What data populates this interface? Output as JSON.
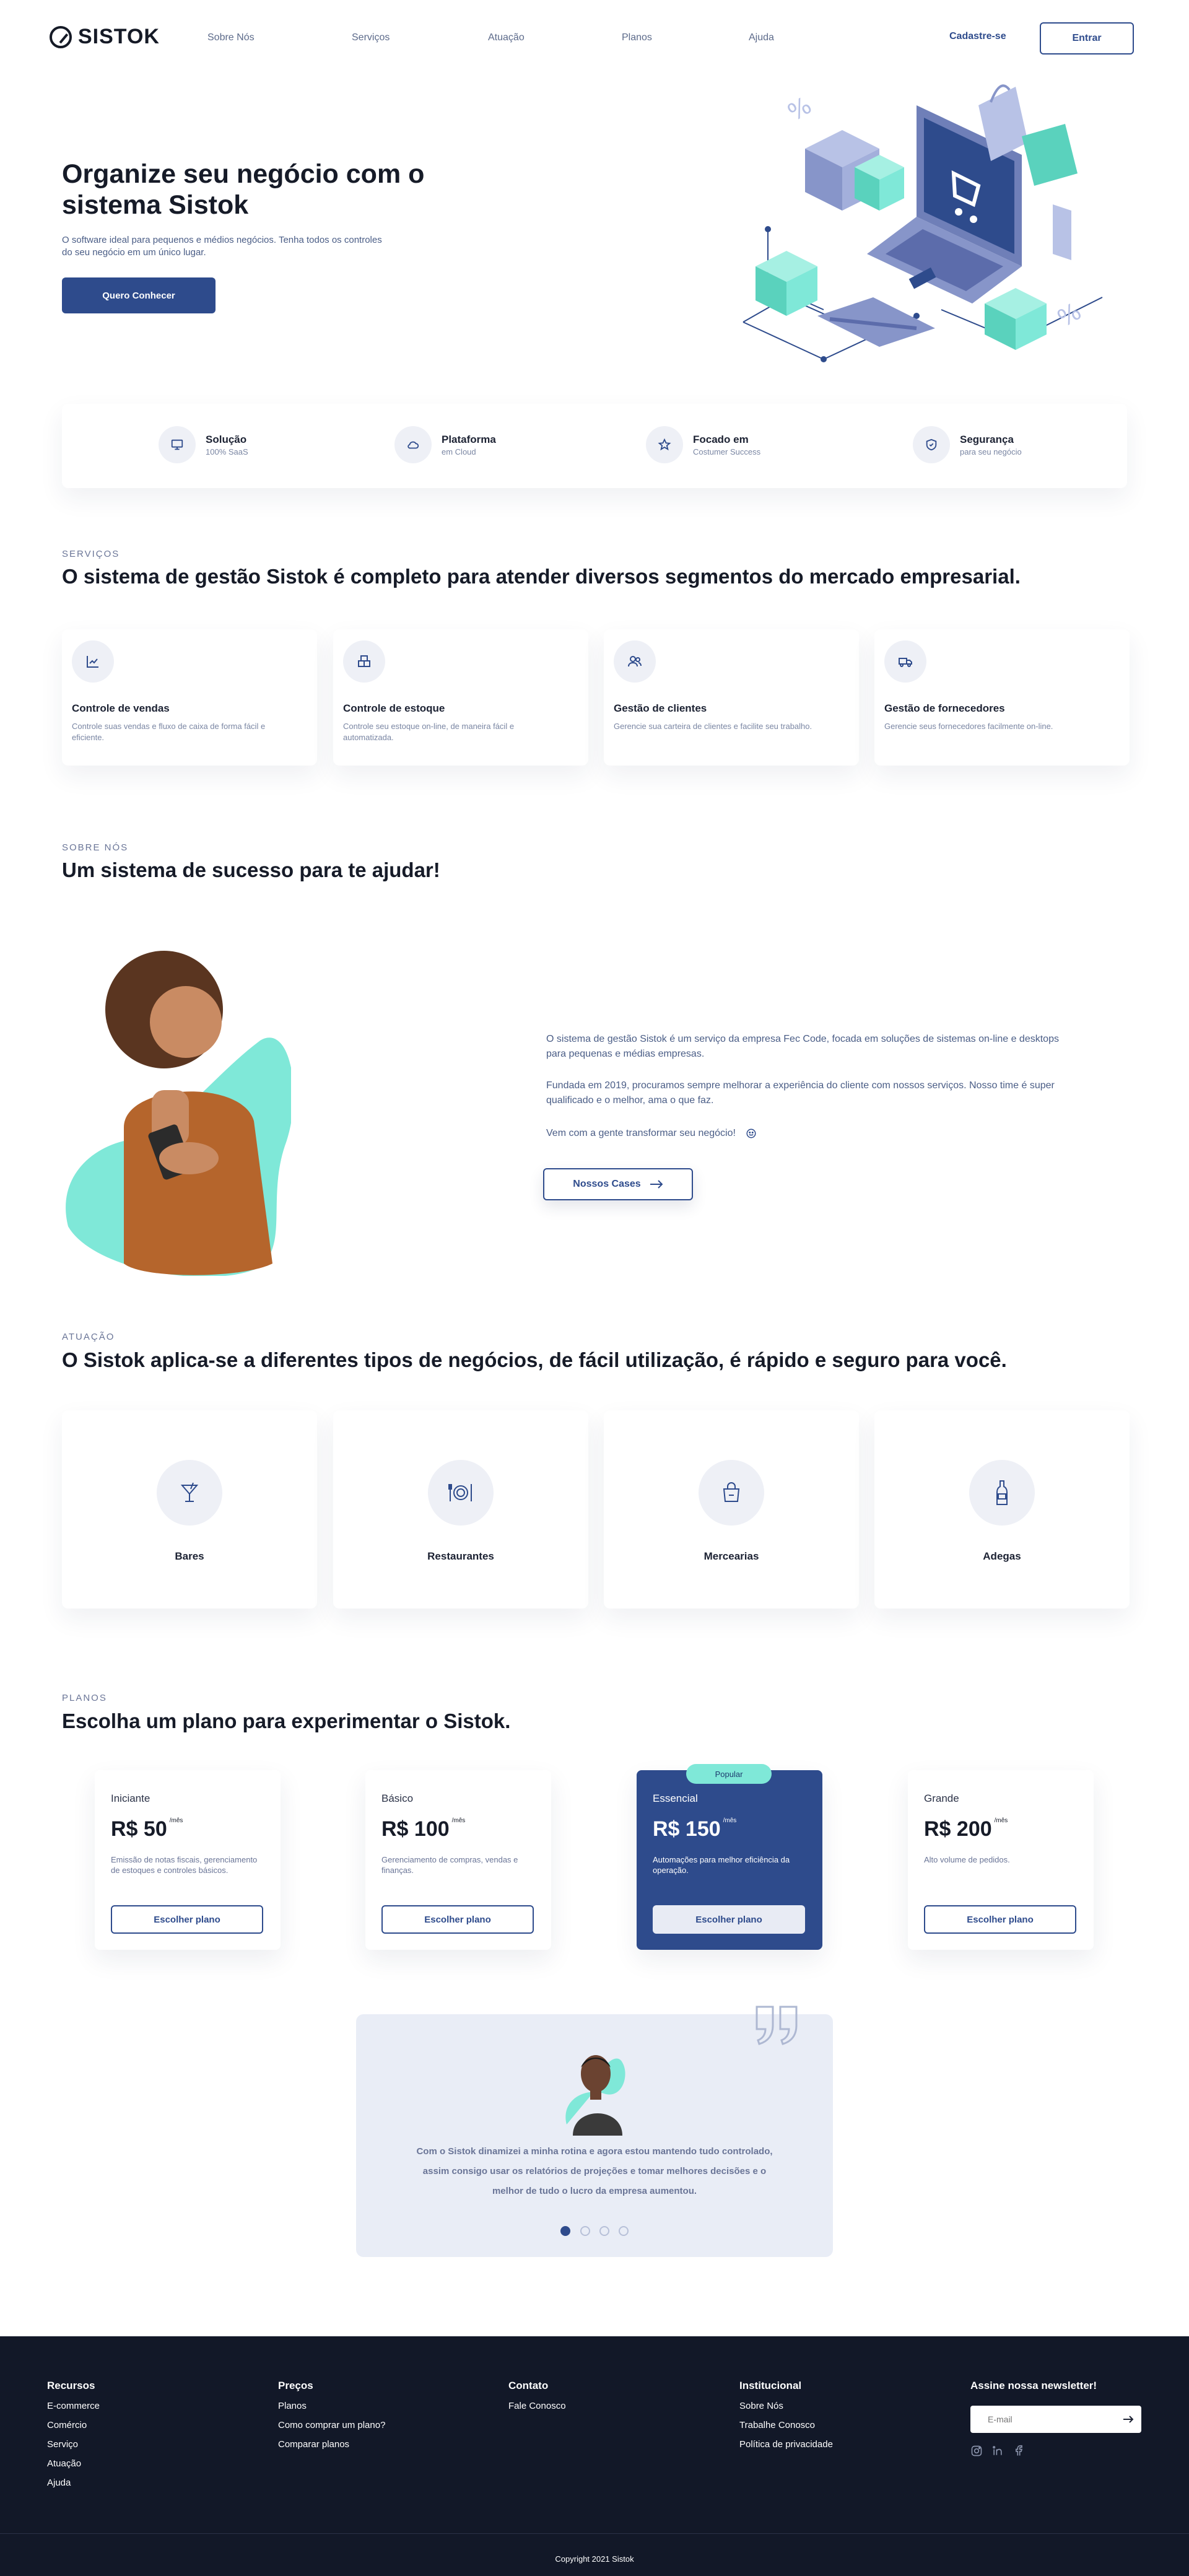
{
  "header": {
    "brand": "SISTOK",
    "nav": [
      "Sobre Nós",
      "Serviços",
      "Atuação",
      "Planos",
      "Ajuda"
    ],
    "signup": "Cadastre-se",
    "login": "Entrar"
  },
  "hero": {
    "title": "Organize seu negócio com o sistema Sistok",
    "subtitle": "O software ideal para pequenos e médios negócios. Tenha todos os controles do seu negócio em um único lugar.",
    "cta": "Quero Conhecer"
  },
  "features": [
    {
      "title": "Solução",
      "subtitle": "100% SaaS",
      "icon": "monitor-icon"
    },
    {
      "title": "Plataforma",
      "subtitle": "em Cloud",
      "icon": "cloud-icon"
    },
    {
      "title": "Focado em",
      "subtitle": "Costumer Success",
      "icon": "star-icon"
    },
    {
      "title": "Segurança",
      "subtitle": "para seu negócio",
      "icon": "shield-icon"
    }
  ],
  "services": {
    "eyebrow": "SERVIÇOS",
    "title": "O sistema de gestão Sistok é completo para atender diversos segmentos do mercado empresarial.",
    "items": [
      {
        "title": "Controle de vendas",
        "desc": "Controle suas vendas e fluxo de caixa de forma fácil e eficiente.",
        "icon": "chart-icon"
      },
      {
        "title": "Controle de estoque",
        "desc": "Controle seu estoque on-line, de maneira fácil e automatizada.",
        "icon": "boxes-icon"
      },
      {
        "title": "Gestão de clientes",
        "desc": "Gerencie sua carteira de clientes e facilite seu trabalho.",
        "icon": "users-icon"
      },
      {
        "title": "Gestão de fornecedores",
        "desc": "Gerencie seus fornecedores facilmente on-line.",
        "icon": "truck-icon"
      }
    ]
  },
  "about": {
    "eyebrow": "SOBRE NÓS",
    "title": "Um sistema de sucesso para te ajudar!",
    "p1": "O sistema de gestão Sistok é um serviço da empresa Fec Code, focada em soluções de sistemas on-line e desktops para pequenas e médias empresas.",
    "p2": "Fundada em 2019, procuramos sempre melhorar a experiência do cliente com nossos serviços. Nosso time é super qualificado e o melhor, ama o que faz.",
    "p3": "Vem com a gente transformar seu negócio!",
    "cta": "Nossos Cases"
  },
  "industries": {
    "eyebrow": "ATUAÇÃO",
    "title": "O Sistok aplica-se a diferentes tipos de negócios, de fácil utilização, é rápido e seguro para você.",
    "items": [
      {
        "label": "Bares",
        "icon": "cocktail-icon"
      },
      {
        "label": "Restaurantes",
        "icon": "dinner-plate-icon"
      },
      {
        "label": "Mercearias",
        "icon": "shopping-bag-icon"
      },
      {
        "label": "Adegas",
        "icon": "wine-bottle-icon"
      }
    ]
  },
  "plans": {
    "eyebrow": "PLANOS",
    "title": "Escolha um plano para experimentar o Sistok.",
    "badge": "Popular",
    "unit": "/mês",
    "items": [
      {
        "name": "Iniciante",
        "price": "R$ 50",
        "desc": "Emissão de notas fiscais, gerenciamento de estoques e controles básicos.",
        "cta": "Escolher plano"
      },
      {
        "name": "Básico",
        "price": "R$ 100",
        "desc": "Gerenciamento de compras, vendas e finanças.",
        "cta": "Escolher plano"
      },
      {
        "name": "Essencial",
        "price": "R$ 150",
        "desc": "Automações para melhor eficiência da operação.",
        "cta": "Escolher plano"
      },
      {
        "name": "Grande",
        "price": "R$ 200",
        "desc": "Alto volume de pedidos.",
        "cta": "Escolher plano"
      }
    ]
  },
  "testimonial": {
    "text": "Com o Sistok dinamizei a minha rotina e agora estou mantendo tudo controlado, assim consigo usar os relatórios de projeções e tomar melhores decisões e o melhor de tudo o lucro da empresa aumentou."
  },
  "footer": {
    "columns": [
      {
        "title": "Recursos",
        "items": [
          "E-commerce",
          "Comércio",
          "Serviço",
          "Atuação",
          "Ajuda"
        ]
      },
      {
        "title": "Preços",
        "items": [
          "Planos",
          "Como comprar um plano?",
          "Comparar planos"
        ]
      },
      {
        "title": "Contato",
        "items": [
          "Fale Conosco"
        ]
      },
      {
        "title": "Institucional",
        "items": [
          "Sobre Nós",
          "Trabalhe Conosco",
          "Política de privacidade"
        ]
      }
    ],
    "newsletter_title": "Assine nossa newsletter!",
    "newsletter_placeholder": "E-mail",
    "copyright": "Copyright 2021 Sistok"
  },
  "colors": {
    "primary": "#2e4b8c",
    "accent": "#7fe8d8",
    "dark": "#121828"
  }
}
